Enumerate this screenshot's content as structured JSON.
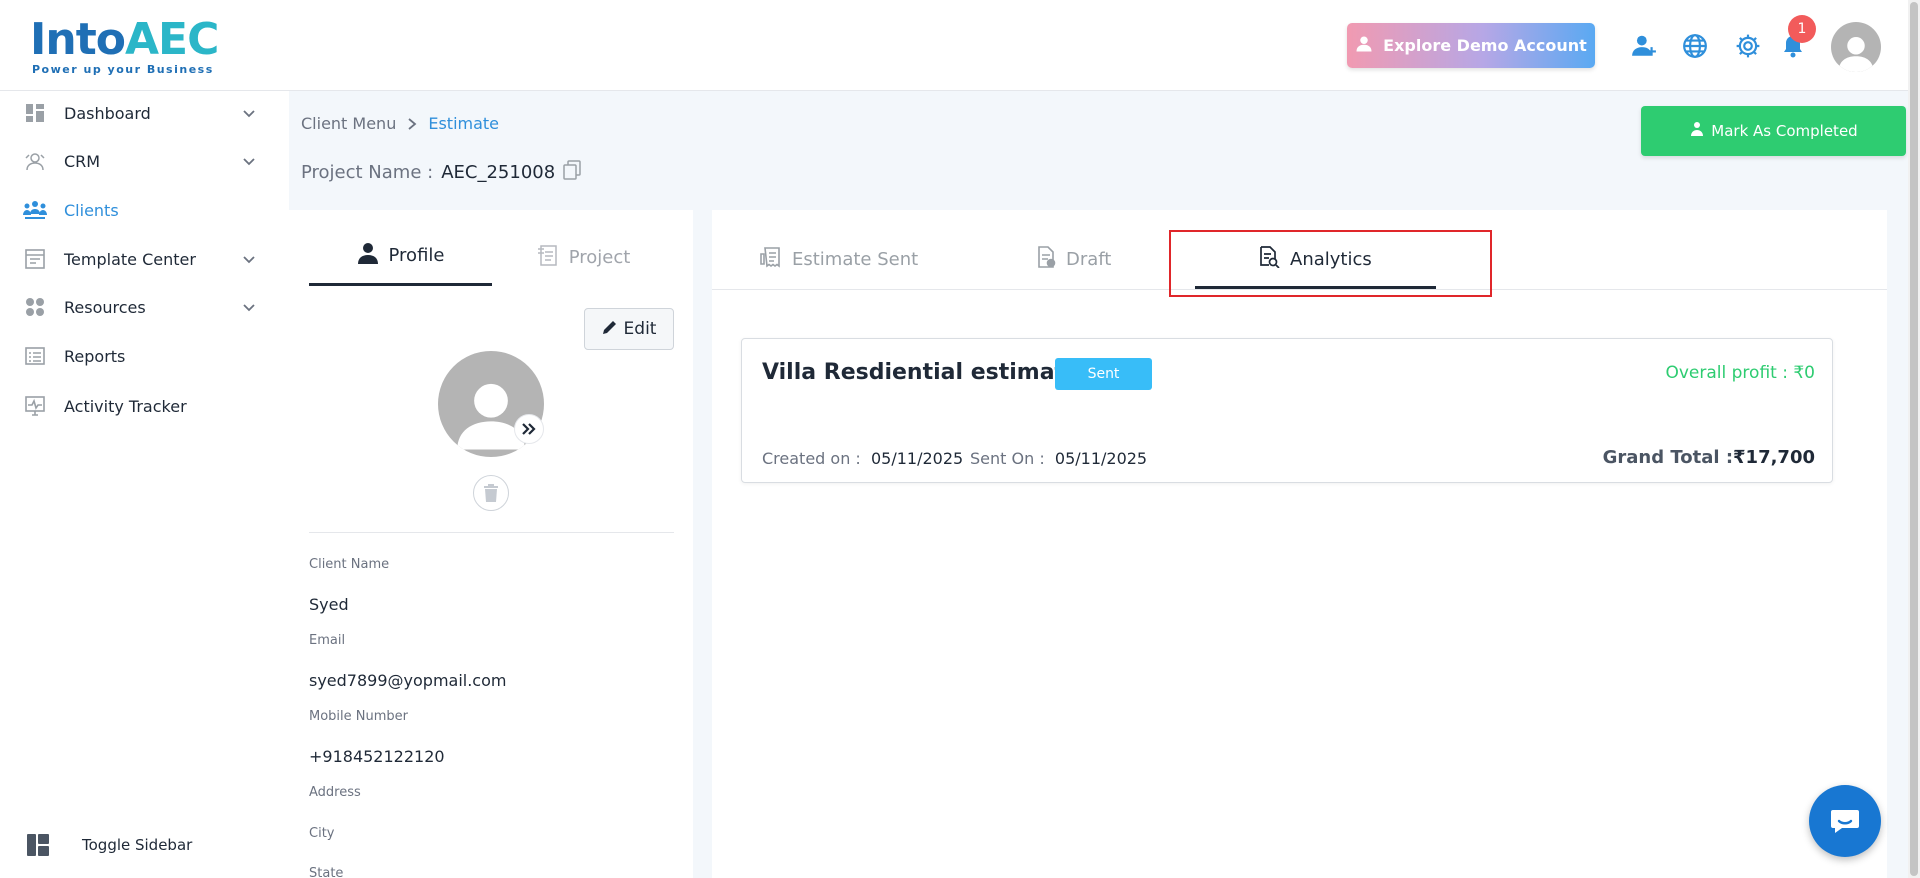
{
  "header": {
    "logo_into": "Into",
    "logo_aec": "AEC",
    "logo_tagline": "Power up your Business",
    "demo_button": "Explore Demo Account",
    "notification_count": "1",
    "icons": [
      "add-user-icon",
      "globe-icon",
      "settings-icon",
      "bell-icon",
      "user-avatar"
    ]
  },
  "sidebar": {
    "items": [
      {
        "label": "Dashboard",
        "icon": "dashboard-icon",
        "has_chevron": true
      },
      {
        "label": "CRM",
        "icon": "crm-icon",
        "has_chevron": true
      },
      {
        "label": "Clients",
        "icon": "clients-icon",
        "has_chevron": false,
        "active": true
      },
      {
        "label": "Template Center",
        "icon": "template-icon",
        "has_chevron": true
      },
      {
        "label": "Resources",
        "icon": "resources-icon",
        "has_chevron": true
      },
      {
        "label": "Reports",
        "icon": "reports-icon",
        "has_chevron": false
      },
      {
        "label": "Activity Tracker",
        "icon": "activity-icon",
        "has_chevron": false
      }
    ],
    "toggle_label": "Toggle Sidebar"
  },
  "breadcrumb": {
    "root": "Client Menu",
    "current": "Estimate"
  },
  "project": {
    "label": "Project Name :",
    "value": "AEC_251008"
  },
  "mark_completed_button": "Mark As Completed",
  "profile_tabs": [
    {
      "label": "Profile",
      "active": true
    },
    {
      "label": "Project",
      "active": false
    }
  ],
  "profile": {
    "edit_button": "Edit",
    "fields": [
      {
        "label": "Client Name",
        "value": "Syed"
      },
      {
        "label": "Email",
        "value": "syed7899@yopmail.com"
      },
      {
        "label": "Mobile Number",
        "value": "+918452122120"
      },
      {
        "label": "Address",
        "value": ""
      },
      {
        "label": "City",
        "value": ""
      },
      {
        "label": "State",
        "value": ""
      }
    ]
  },
  "estimate_tabs": [
    {
      "label": "Estimate Sent",
      "active": false
    },
    {
      "label": "Draft",
      "active": false
    },
    {
      "label": "Analytics",
      "active": true
    }
  ],
  "estimate": {
    "title": "Villa Resdiential estimate",
    "status": "Sent",
    "overall_profit": "Overall profit : ₹0",
    "created_label": "Created on :",
    "created_value": "05/11/2025",
    "sent_label": "Sent On :",
    "sent_value": "05/11/2025",
    "grand_total_label": "Grand Total :",
    "grand_total_value": "₹17,700"
  },
  "colors": {
    "accent_blue": "#2f8fdb",
    "success_green": "#2ecc71",
    "badge_red": "#f25b5b",
    "highlight_red": "#e0262a"
  }
}
